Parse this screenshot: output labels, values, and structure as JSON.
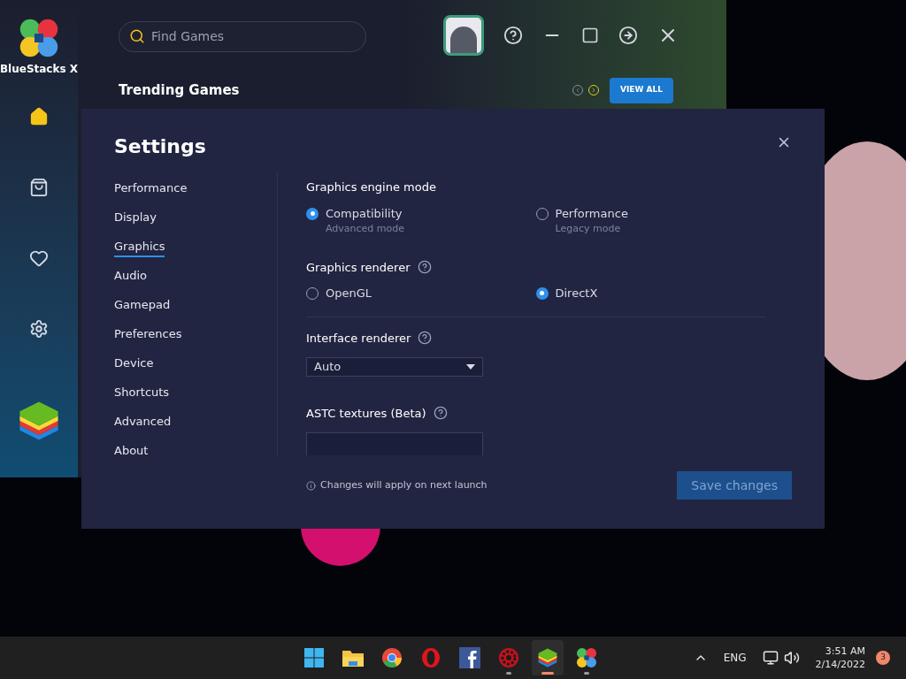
{
  "app": {
    "logo_text": "BlueStacks X",
    "search": {
      "placeholder": "Find Games"
    },
    "section_title": "Trending Games",
    "view_all": "VIEW ALL",
    "nav": [
      {
        "kind": "home",
        "selected": true
      },
      {
        "kind": "store",
        "selected": false
      },
      {
        "kind": "favorites",
        "selected": false
      },
      {
        "kind": "settings",
        "selected": false
      }
    ]
  },
  "settings": {
    "title": "Settings",
    "menu": [
      {
        "label": "Performance",
        "selected": false
      },
      {
        "label": "Display",
        "selected": false
      },
      {
        "label": "Graphics",
        "selected": true
      },
      {
        "label": "Audio",
        "selected": false
      },
      {
        "label": "Gamepad",
        "selected": false
      },
      {
        "label": "Preferences",
        "selected": false
      },
      {
        "label": "Device",
        "selected": false
      },
      {
        "label": "Shortcuts",
        "selected": false
      },
      {
        "label": "Advanced",
        "selected": false
      },
      {
        "label": "About",
        "selected": false
      }
    ],
    "engine_mode": {
      "label": "Graphics engine mode",
      "options": [
        {
          "label": "Compatibility",
          "sublabel": "Advanced mode",
          "selected": true
        },
        {
          "label": "Performance",
          "sublabel": "Legacy mode",
          "selected": false
        }
      ]
    },
    "renderer": {
      "label": "Graphics renderer",
      "options": [
        {
          "label": "OpenGL",
          "selected": false
        },
        {
          "label": "DirectX",
          "selected": true
        }
      ]
    },
    "interface_renderer": {
      "label": "Interface renderer",
      "value": "Auto"
    },
    "astc": {
      "label": "ASTC textures (Beta)"
    },
    "note": "Changes will apply on next launch",
    "save": {
      "label": "Save changes",
      "disabled": true
    }
  },
  "taskbar": {
    "apps": [
      {
        "kind": "start",
        "running": false,
        "selected": false
      },
      {
        "kind": "files",
        "running": false,
        "selected": false
      },
      {
        "kind": "chrome",
        "running": false,
        "selected": false
      },
      {
        "kind": "opera",
        "running": false,
        "selected": false
      },
      {
        "kind": "facebook",
        "running": false,
        "selected": false
      },
      {
        "kind": "game",
        "running": true,
        "selected": false
      },
      {
        "kind": "bluestacks",
        "running": true,
        "selected": true
      },
      {
        "kind": "bluestacksx",
        "running": true,
        "selected": false
      }
    ],
    "language": "ENG",
    "time": "3:51 AM",
    "date": "2/14/2022",
    "notifications": "3"
  }
}
